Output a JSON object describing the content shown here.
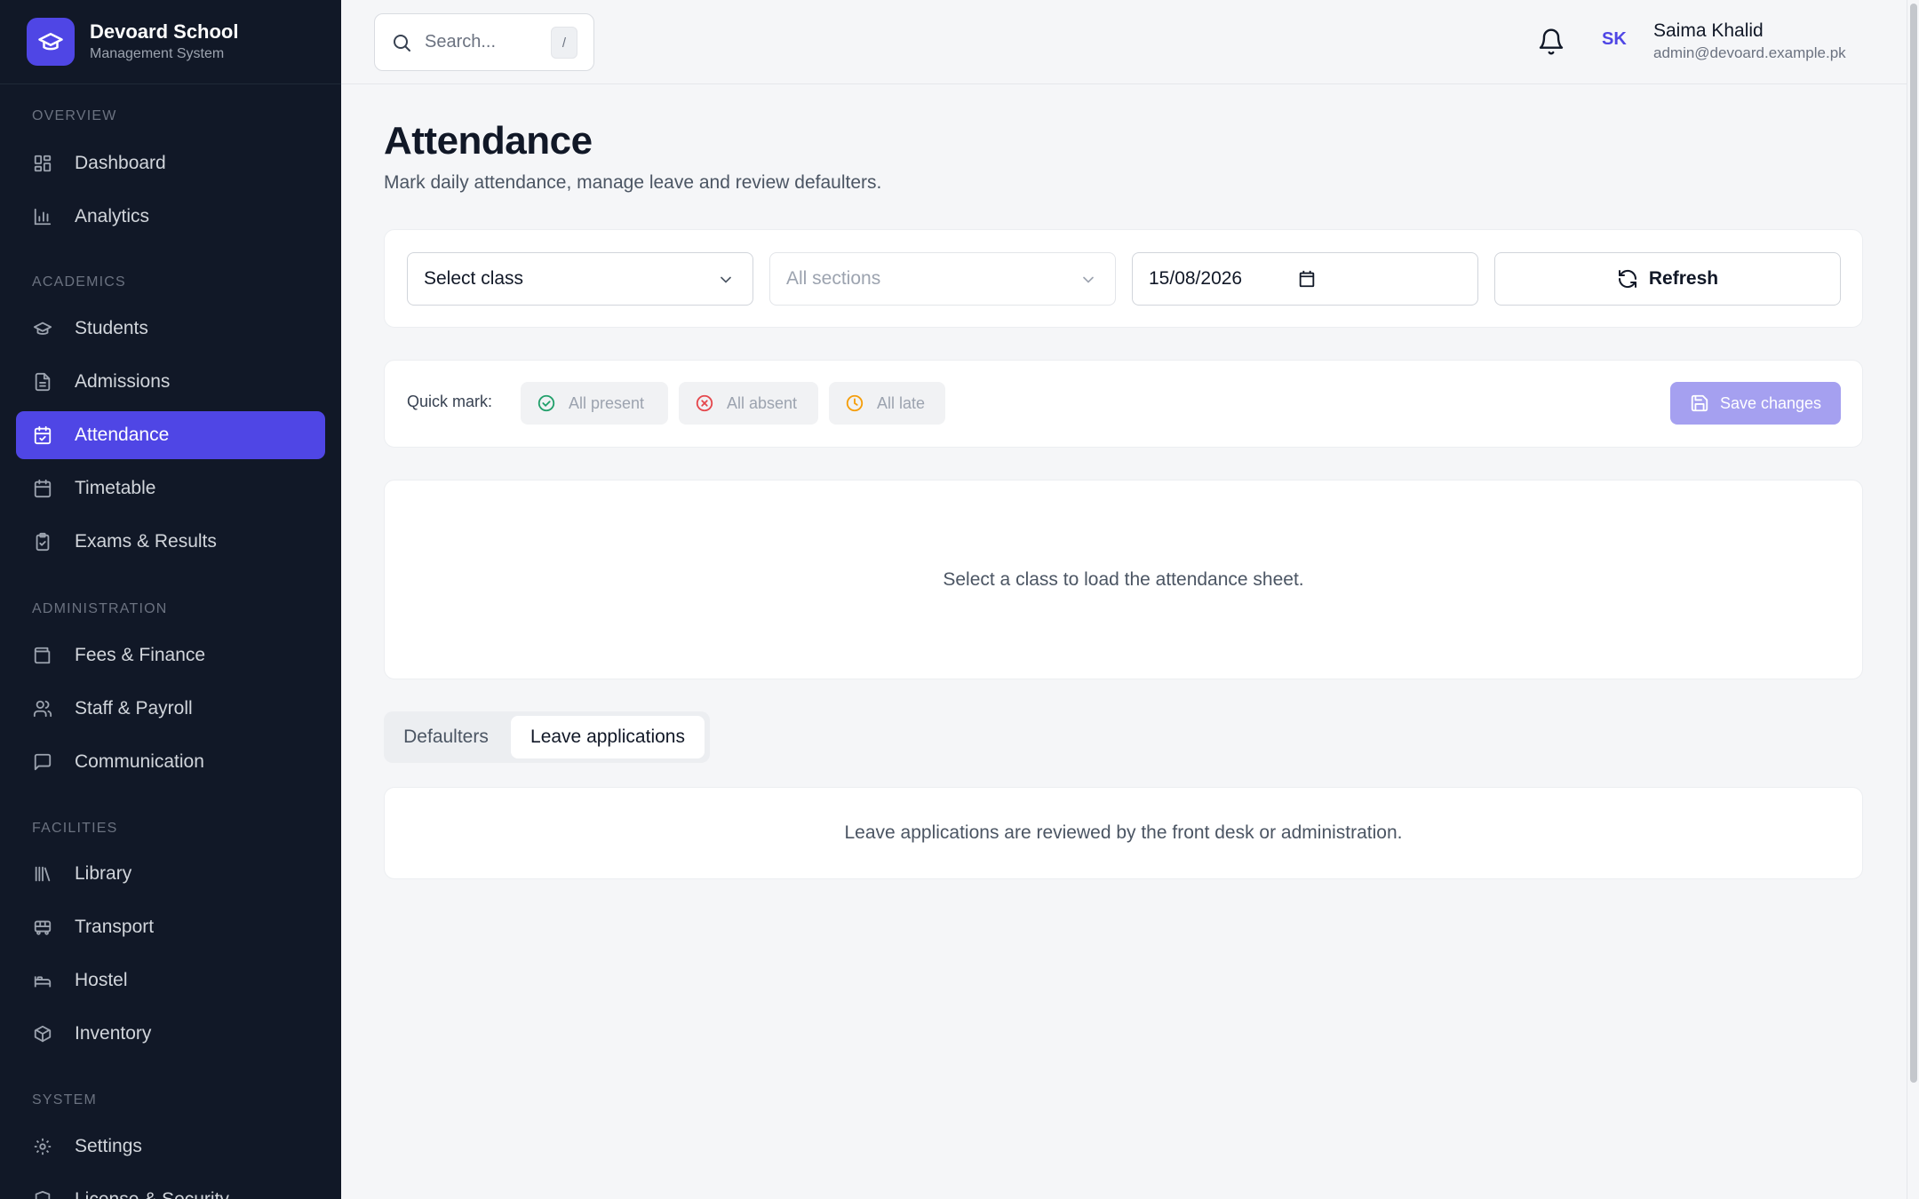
{
  "brand": {
    "name": "Devoard School",
    "subtitle": "Management System",
    "logo_icon": "graduation-cap-icon"
  },
  "search": {
    "placeholder": "Search...",
    "shortcut": "/"
  },
  "user": {
    "initials": "SK",
    "name": "Saima Khalid",
    "email": "admin@devoard.example.pk"
  },
  "sidebar": {
    "sections": {
      "overview": "Overview",
      "academics": "Academics",
      "administration": "Administration",
      "facilities": "Facilities",
      "system": "System"
    },
    "items": [
      {
        "label": "Dashboard",
        "icon": "dashboard-icon"
      },
      {
        "label": "Analytics",
        "icon": "bar-chart-icon"
      },
      {
        "label": "Students",
        "icon": "graduation-cap-icon"
      },
      {
        "label": "Admissions",
        "icon": "document-icon"
      },
      {
        "label": "Attendance",
        "icon": "calendar-check-icon",
        "active": true
      },
      {
        "label": "Timetable",
        "icon": "calendar-icon"
      },
      {
        "label": "Exams & Results",
        "icon": "clipboard-check-icon"
      },
      {
        "label": "Fees & Finance",
        "icon": "wallet-icon"
      },
      {
        "label": "Staff & Payroll",
        "icon": "users-icon"
      },
      {
        "label": "Communication",
        "icon": "message-icon"
      },
      {
        "label": "Library",
        "icon": "library-icon"
      },
      {
        "label": "Transport",
        "icon": "bus-icon"
      },
      {
        "label": "Hostel",
        "icon": "bed-icon"
      },
      {
        "label": "Inventory",
        "icon": "package-icon"
      },
      {
        "label": "Settings",
        "icon": "gear-icon"
      },
      {
        "label": "License & Security",
        "icon": "shield-icon"
      }
    ]
  },
  "page": {
    "title": "Attendance",
    "subtitle": "Mark daily attendance, manage leave and review defaulters."
  },
  "filters": {
    "class_select": "Select class",
    "section_select": "All sections",
    "date": "15/08/2026",
    "refresh_label": "Refresh"
  },
  "quick_mark": {
    "label": "Quick mark:",
    "all_present": "All present",
    "all_absent": "All absent",
    "all_late": "All late",
    "save_label": "Save changes"
  },
  "sheet": {
    "empty_message": "Select a class to load the attendance sheet."
  },
  "tabs": {
    "defaulters": "Defaulters",
    "leave": "Leave applications"
  },
  "leave_panel": {
    "message": "Leave applications are reviewed by the front desk or administration."
  },
  "colors": {
    "accent": "#4f46e5",
    "sidebar_bg": "#111827",
    "present": "#22a06b",
    "absent": "#e5484d",
    "late": "#f59e0b"
  }
}
